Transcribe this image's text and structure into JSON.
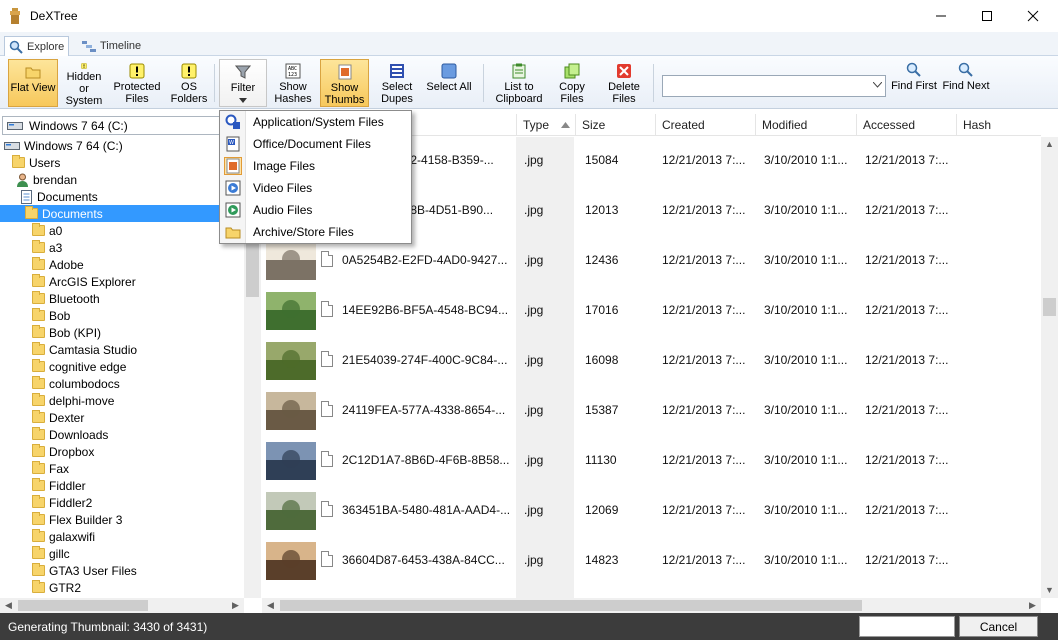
{
  "window": {
    "title": "DeXTree",
    "minimize_icon": "minimize-icon",
    "maximize_icon": "maximize-icon",
    "close_icon": "close-icon"
  },
  "tabs": [
    {
      "label": "Explore",
      "icon": "explore-icon",
      "active": true
    },
    {
      "label": "Timeline",
      "icon": "timeline-icon",
      "active": false
    }
  ],
  "ribbon": {
    "flat_view": "Flat View",
    "hidden_system": "Hidden\nor System",
    "protected_files": "Protected\nFiles",
    "os_folders": "OS\nFolders",
    "filter": "Filter",
    "show_hashes": "Show\nHashes",
    "show_thumbs": "Show\nThumbs",
    "select_dupes": "Select\nDupes",
    "select_all": "Select All",
    "list_to_clipboard": "List to\nClipboard",
    "copy_files": "Copy\nFiles",
    "delete_files": "Delete\nFiles",
    "search_value": "",
    "find_first": "Find First",
    "find_next": "Find Next"
  },
  "drive_combo": {
    "value": "Windows 7 64 (C:)"
  },
  "tree": {
    "root": "Windows 7 64 (C:)",
    "users": "Users",
    "user": "brendan",
    "documents_parent": "Documents",
    "documents_selected": "Documents",
    "folders": [
      "a0",
      "a3",
      "Adobe",
      "ArcGIS Explorer",
      "Bluetooth",
      "Bob",
      "Bob (KPI)",
      "Camtasia Studio",
      "cognitive edge",
      "columbodocs",
      "delphi-move",
      "Dexter",
      "Downloads",
      "Dropbox",
      "Fax",
      "Fiddler",
      "Fiddler2",
      "Flex Builder 3",
      "galaxwifi",
      "gillc",
      "GTA3 User Files",
      "GTR2"
    ]
  },
  "grid": {
    "columns": [
      "Type",
      "Size",
      "Created",
      "Modified",
      "Accessed",
      "Hash"
    ],
    "rows": [
      {
        "name": "772-4158-B359-...",
        "type": ".jpg",
        "size": "15084",
        "created": "12/21/2013 7:...",
        "modified": "3/10/2010 1:1...",
        "accessed": "12/21/2013 7:..."
      },
      {
        "name": "038B-4D51-B90...",
        "type": ".jpg",
        "size": "12013",
        "created": "12/21/2013 7:...",
        "modified": "3/10/2010 1:1...",
        "accessed": "12/21/2013 7:..."
      },
      {
        "name": "0A5254B2-E2FD-4AD0-9427...",
        "type": ".jpg",
        "size": "12436",
        "created": "12/21/2013 7:...",
        "modified": "3/10/2010 1:1...",
        "accessed": "12/21/2013 7:..."
      },
      {
        "name": "14EE92B6-BF5A-4548-BC94...",
        "type": ".jpg",
        "size": "17016",
        "created": "12/21/2013 7:...",
        "modified": "3/10/2010 1:1...",
        "accessed": "12/21/2013 7:..."
      },
      {
        "name": "21E54039-274F-400C-9C84-...",
        "type": ".jpg",
        "size": "16098",
        "created": "12/21/2013 7:...",
        "modified": "3/10/2010 1:1...",
        "accessed": "12/21/2013 7:..."
      },
      {
        "name": "24119FEA-577A-4338-8654-...",
        "type": ".jpg",
        "size": "15387",
        "created": "12/21/2013 7:...",
        "modified": "3/10/2010 1:1...",
        "accessed": "12/21/2013 7:..."
      },
      {
        "name": "2C12D1A7-8B6D-4F6B-8B58...",
        "type": ".jpg",
        "size": "11130",
        "created": "12/21/2013 7:...",
        "modified": "3/10/2010 1:1...",
        "accessed": "12/21/2013 7:..."
      },
      {
        "name": "363451BA-5480-481A-AAD4-...",
        "type": ".jpg",
        "size": "12069",
        "created": "12/21/2013 7:...",
        "modified": "3/10/2010 1:1...",
        "accessed": "12/21/2013 7:..."
      },
      {
        "name": "36604D87-6453-438A-84CC...",
        "type": ".jpg",
        "size": "14823",
        "created": "12/21/2013 7:...",
        "modified": "3/10/2010 1:1...",
        "accessed": "12/21/2013 7:..."
      }
    ]
  },
  "filter_menu": [
    {
      "label": "Application/System Files",
      "icon": "application-icon"
    },
    {
      "label": "Office/Document Files",
      "icon": "document-icon"
    },
    {
      "label": "Image Files",
      "icon": "image-icon"
    },
    {
      "label": "Video Files",
      "icon": "video-icon"
    },
    {
      "label": "Audio Files",
      "icon": "audio-icon"
    },
    {
      "label": "Archive/Store Files",
      "icon": "archive-icon"
    }
  ],
  "status": {
    "text": "Generating Thumbnail: 3430 of 3431)",
    "cancel": "Cancel"
  },
  "colors": {
    "accent": "#f7c85c",
    "selection": "#3399ff",
    "statusbar": "#3c3c3c"
  }
}
